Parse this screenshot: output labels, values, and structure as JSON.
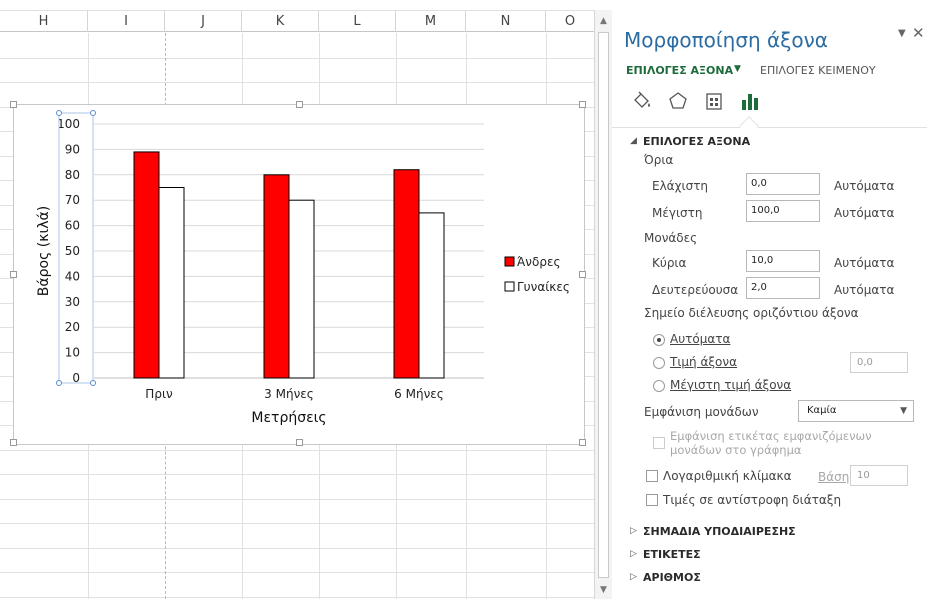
{
  "sheet": {
    "columns": [
      "H",
      "I",
      "J",
      "K",
      "L",
      "M",
      "N",
      "O"
    ]
  },
  "chart_data": {
    "type": "bar",
    "categories": [
      "Πριν",
      "3 Μήνες",
      "6 Μήνες"
    ],
    "series": [
      {
        "name": "Άνδρες",
        "values": [
          89,
          80,
          82
        ],
        "color": "#ff0000"
      },
      {
        "name": "Γυναίκες",
        "values": [
          75,
          70,
          65
        ],
        "color": "#ffffff"
      }
    ],
    "xlabel": "Μετρήσεις",
    "ylabel": "Βάρος (κιλά)",
    "ylim": [
      0,
      100
    ],
    "yticks": [
      0,
      10,
      20,
      30,
      40,
      50,
      60,
      70,
      80,
      90,
      100
    ],
    "grid": true,
    "legend": "right"
  },
  "pane": {
    "title": "Μορφοποίηση άξονα",
    "close_glyph": "✕",
    "dropdown_glyph": "▼",
    "tabs": {
      "axis_options": "ΕΠΙΛΟΓΕΣ ΑΞΟΝΑ",
      "text_options": "ΕΠΙΛΟΓΕΣ ΚΕΙΜΕΝΟΥ"
    },
    "icons": [
      "fill-line-icon",
      "effects-icon",
      "size-properties-icon",
      "axis-options-icon"
    ],
    "section_axis": "ΕΠΙΛΟΓΕΣ ΑΞΟΝΑ",
    "bounds_label": "Όρια",
    "minimum_label": "Ελάχιστη",
    "minimum_value": "0,0",
    "maximum_label": "Μέγιστη",
    "maximum_value": "100,0",
    "units_label": "Μονάδες",
    "major_label": "Κύρια",
    "major_value": "10,0",
    "minor_label": "Δευτερεύουσα",
    "minor_value": "2,0",
    "auto_label": "Αυτόματα",
    "crosses_label": "Σημείο διέλευσης οριζόντιου άξονα",
    "radio_auto": "Αυτόματα",
    "radio_value": "Τιμή άξονα",
    "radio_value_input": "0,0",
    "radio_max": "Μέγιστη τιμή άξονα",
    "display_units_label": "Εμφάνιση μονάδων",
    "display_units_value": "Καμία",
    "show_units_label": "Εμφάνιση ετικέτας εμφανιζόμενων μονάδων στο γράφημα",
    "log_scale_label": "Λογαριθμική κλίμακα",
    "base_label": "Βάση",
    "base_value": "10",
    "reverse_label": "Τιμές σε αντίστροφη διάταξη",
    "section_ticks": "ΣΗΜΑΔΙΑ ΥΠΟΔΙΑΙΡΕΣΗΣ",
    "section_labels": "ΕΤΙΚΕΤΕΣ",
    "section_number": "ΑΡΙΘΜΟΣ"
  }
}
